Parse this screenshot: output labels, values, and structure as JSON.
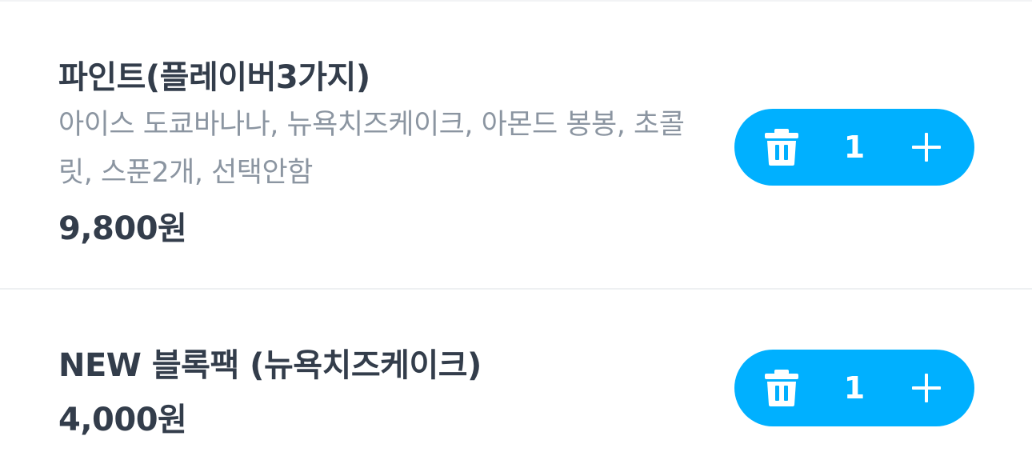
{
  "cart": {
    "items": [
      {
        "name": "파인트(플레이버3가지)",
        "options": "아이스 도쿄바나나, 뉴욕치즈케이크, 아몬드 봉봉, 초콜릿, 스푼2개, 선택안함",
        "price": "9,800원",
        "quantity": "1",
        "delete_icon": "trash-icon",
        "increase_icon": "plus-icon"
      },
      {
        "name": "NEW 블록팩 (뉴욕치즈케이크)",
        "price": "4,000원",
        "quantity": "1",
        "delete_icon": "trash-icon",
        "increase_icon": "plus-icon"
      }
    ]
  },
  "colors": {
    "stepper_background": "#00b0ff",
    "title_text": "#333d4b",
    "option_text": "#8b95a1",
    "divider": "#eef0f2"
  }
}
